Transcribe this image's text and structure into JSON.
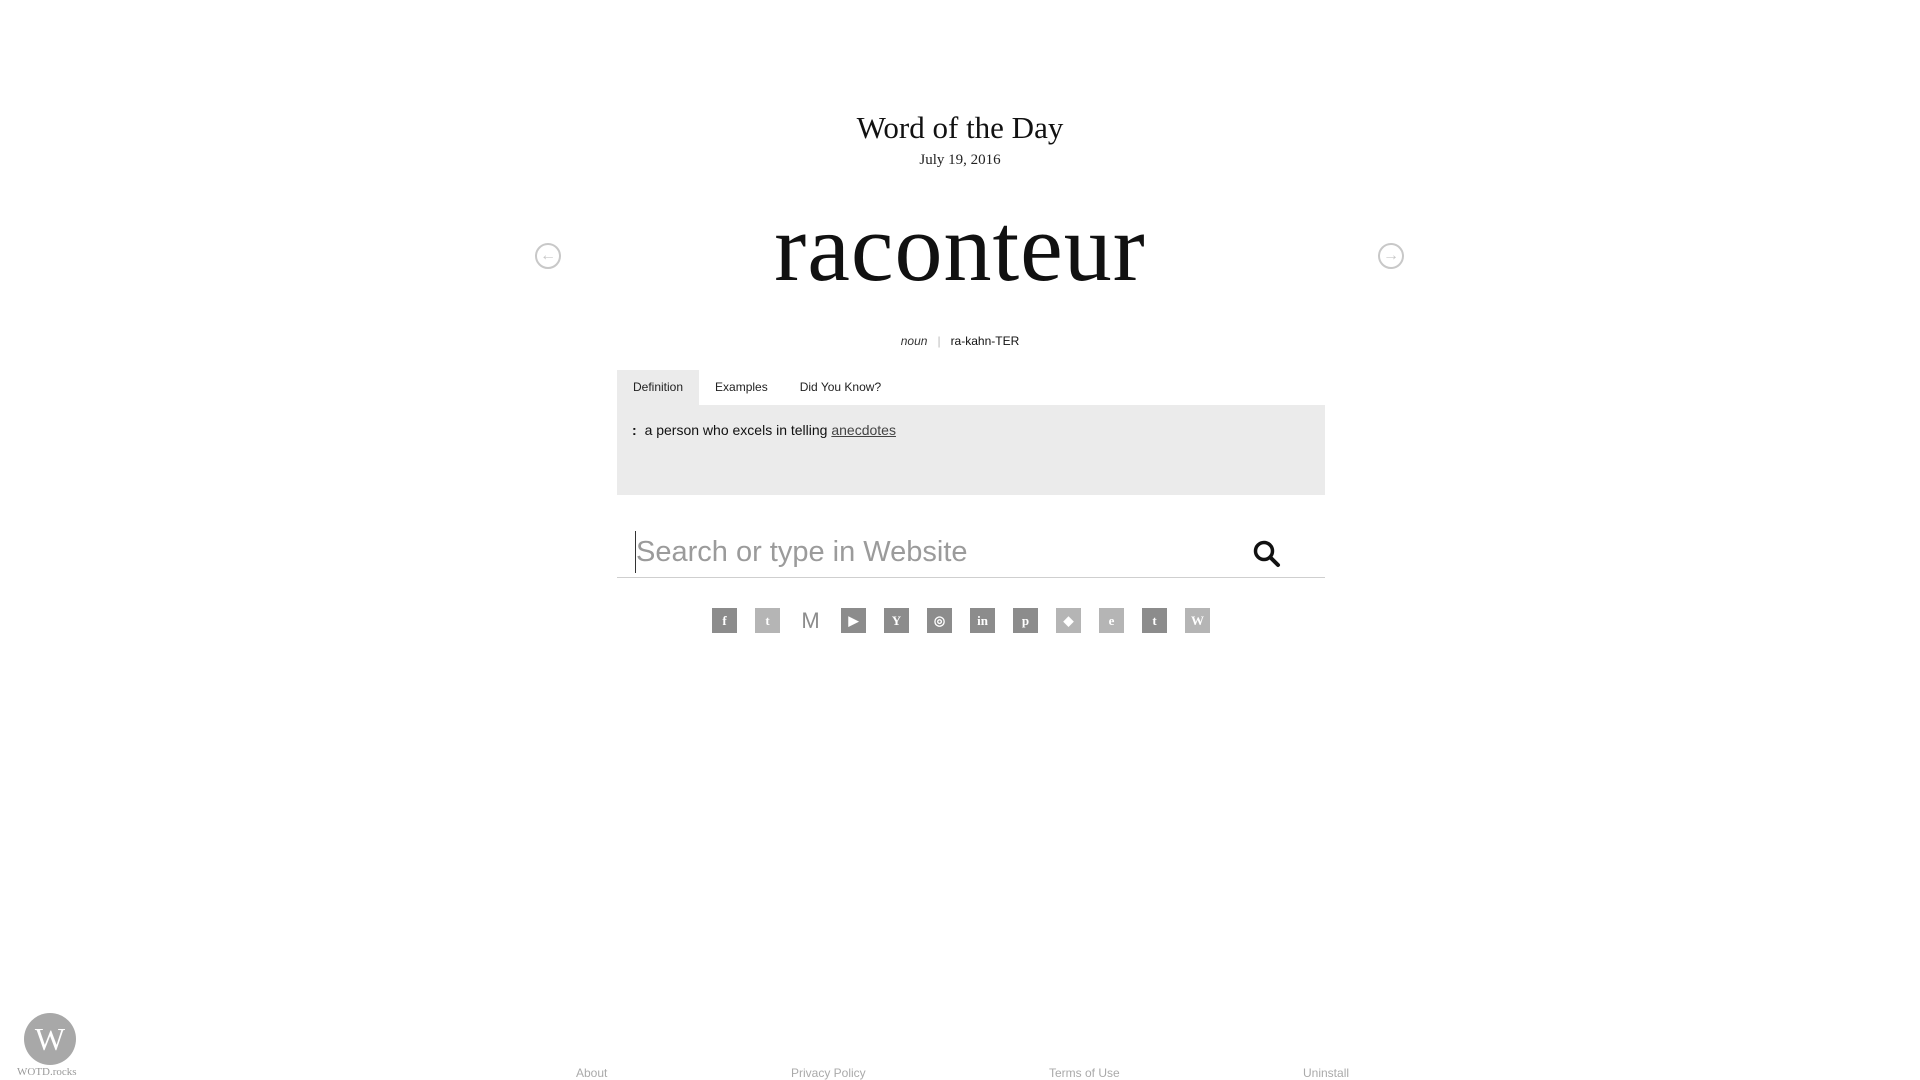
{
  "header": {
    "title": "Word of the Day",
    "date": "July 19, 2016"
  },
  "word": {
    "text": "raconteur",
    "part_of_speech": "noun",
    "pronunciation": "ra-kahn-TER",
    "prev_arrow": "←",
    "next_arrow": "→"
  },
  "tabs": [
    {
      "label": "Definition",
      "active": true
    },
    {
      "label": "Examples",
      "active": false
    },
    {
      "label": "Did You Know?",
      "active": false
    }
  ],
  "definition": {
    "colon": ":",
    "text": "a person who excels in telling",
    "link": "anecdotes"
  },
  "search": {
    "placeholder": "Search or type in Website",
    "icon": "search-icon"
  },
  "social": [
    {
      "name": "facebook",
      "glyph": "f"
    },
    {
      "name": "twitter",
      "glyph": "t"
    },
    {
      "name": "gmail",
      "glyph": "M"
    },
    {
      "name": "youtube",
      "glyph": "▶"
    },
    {
      "name": "yahoo",
      "glyph": "Y"
    },
    {
      "name": "instagram",
      "glyph": "◎"
    },
    {
      "name": "linkedin",
      "glyph": "in"
    },
    {
      "name": "pinterest",
      "glyph": "p"
    },
    {
      "name": "dropbox",
      "glyph": "◆"
    },
    {
      "name": "evernote",
      "glyph": "e"
    },
    {
      "name": "tumblr",
      "glyph": "t"
    },
    {
      "name": "wikipedia",
      "glyph": "W"
    }
  ],
  "brand": {
    "logo_letter": "W",
    "name": "WOTD.rocks"
  },
  "footer": {
    "about": "About",
    "privacy": "Privacy Policy",
    "terms": "Terms of Use",
    "uninstall": "Uninstall"
  },
  "colors": {
    "panel_bg": "#ebebeb",
    "icon_gray": "#8c8c8c",
    "footer_text": "#aaaaaa"
  }
}
